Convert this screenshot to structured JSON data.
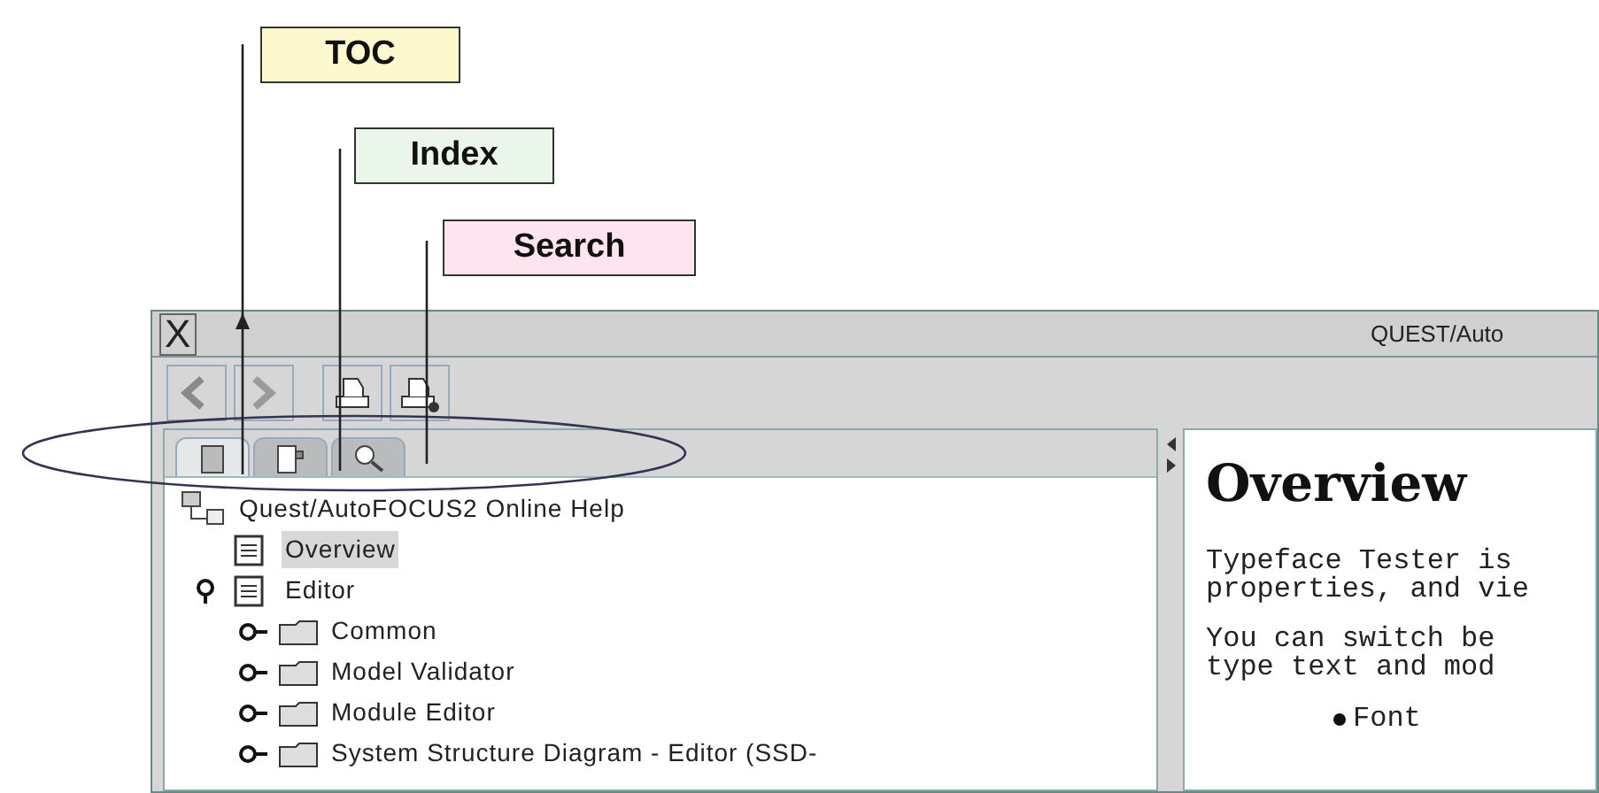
{
  "callouts": [
    {
      "label": "TOC",
      "color": "#fdf9cf"
    },
    {
      "label": "Index",
      "color": "#eaf6ea"
    },
    {
      "label": "Search",
      "color": "#fde4ee"
    }
  ],
  "window": {
    "title": "QUEST/Auto",
    "close_glyph": "X"
  },
  "toolbar": [
    {
      "kind": "back"
    },
    {
      "kind": "forward"
    },
    {
      "kind": "print"
    },
    {
      "kind": "print-setup"
    }
  ],
  "tabs": [
    {
      "kind": "toc",
      "selected": true
    },
    {
      "kind": "index",
      "selected": false
    },
    {
      "kind": "search",
      "selected": false
    }
  ],
  "tree": {
    "label": "Quest/AutoFOCUS2 Online Help",
    "children": [
      {
        "label": "Overview",
        "kind": "page",
        "selected": true
      },
      {
        "label": "Editor",
        "kind": "page",
        "selected": false,
        "expanded": true,
        "children": [
          {
            "label": "Common",
            "kind": "folder",
            "selected": false,
            "expanded": false
          },
          {
            "label": "Model Validator",
            "kind": "folder",
            "selected": false,
            "expanded": false
          },
          {
            "label": "Module Editor",
            "kind": "folder",
            "selected": false,
            "expanded": false
          },
          {
            "label": "System Structure Diagram - Editor (SSD-",
            "kind": "folder",
            "selected": false,
            "expanded": false
          }
        ]
      }
    ]
  },
  "content": {
    "heading": "Overview",
    "paragraphs": [
      [
        "Typeface Tester is",
        "properties, and vie"
      ],
      [
        "You can switch be",
        "type text and mod"
      ]
    ],
    "bullets": [
      "Font"
    ]
  }
}
